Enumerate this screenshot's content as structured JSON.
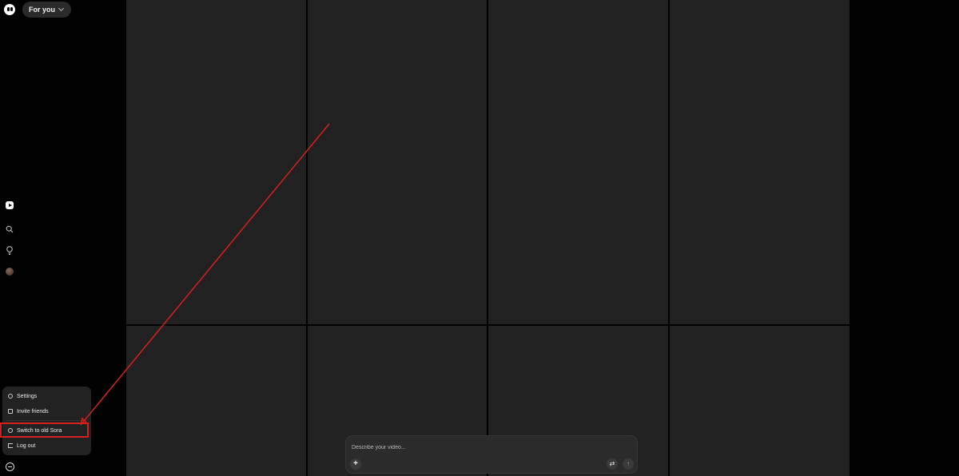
{
  "header": {
    "feed_label": "For you"
  },
  "sidebar": {
    "icons": [
      "logo-icon",
      "home-icon",
      "search-icon",
      "lightbulb-icon",
      "avatar",
      "profile-menu-icon"
    ]
  },
  "menu": {
    "items": [
      {
        "label": "Settings",
        "icon": "gear-icon"
      },
      {
        "label": "Invite friends",
        "icon": "lock-icon"
      },
      {
        "label": "Switch to old Sora",
        "icon": "gear-icon"
      },
      {
        "label": "Log out",
        "icon": "logout-icon"
      }
    ]
  },
  "composer": {
    "placeholder": "Describe your video...",
    "add_label": "+",
    "settings_label": "⇄",
    "send_label": "↑"
  },
  "colors": {
    "annotation": "#d61f1f",
    "tile": "#212121",
    "menu_bg": "#222222"
  }
}
